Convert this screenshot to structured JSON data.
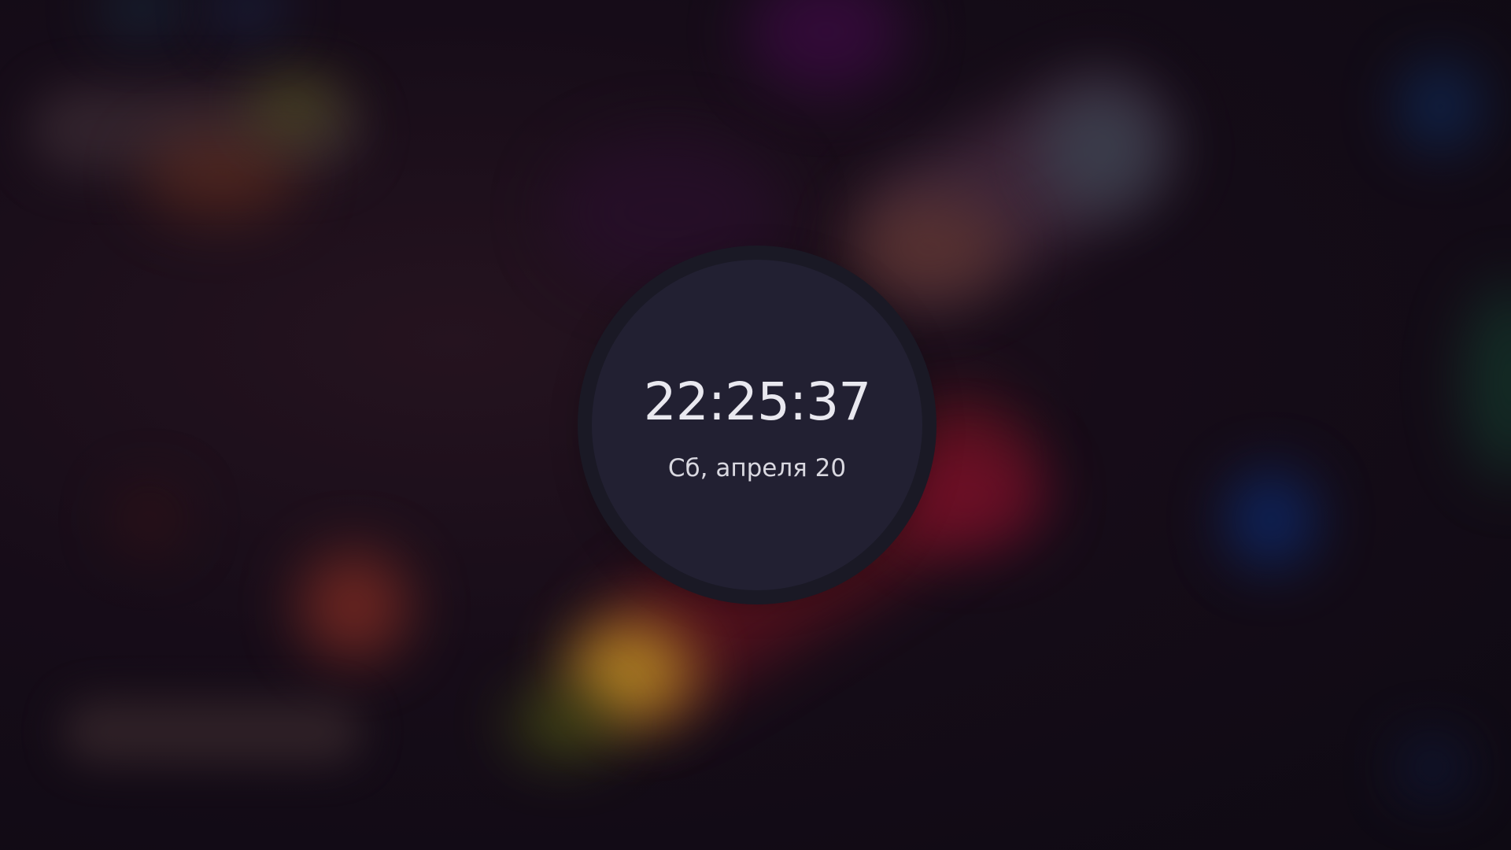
{
  "lockscreen": {
    "clock": {
      "time": "22:25:37",
      "date": "Сб, апреля 20"
    }
  },
  "colors": {
    "clock_face": "#222032",
    "clock_ring": "#1a1925",
    "text": "#e9e8ef",
    "background": "#120a16"
  }
}
